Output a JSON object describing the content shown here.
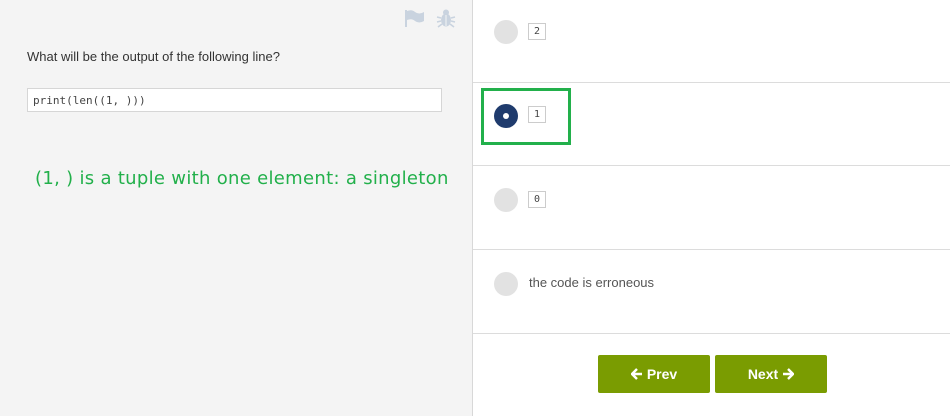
{
  "question": {
    "text": "What will be the output of the following line?",
    "code": "print(len((1, )))"
  },
  "annotation": "(1, ) is a tuple with one element: a singleton",
  "toolbar": {
    "flag_icon": "flag-icon",
    "bug_icon": "bug-icon"
  },
  "options": [
    {
      "label": "2",
      "type": "code",
      "selected": false
    },
    {
      "label": "1",
      "type": "code",
      "selected": true
    },
    {
      "label": "0",
      "type": "code",
      "selected": false
    },
    {
      "label": "the code is erroneous",
      "type": "text",
      "selected": false
    }
  ],
  "nav": {
    "prev_label": "Prev",
    "next_label": "Next"
  },
  "colors": {
    "accent_green": "#22b04b",
    "button_green": "#7a9c01",
    "radio_selected": "#1f3b6d"
  }
}
